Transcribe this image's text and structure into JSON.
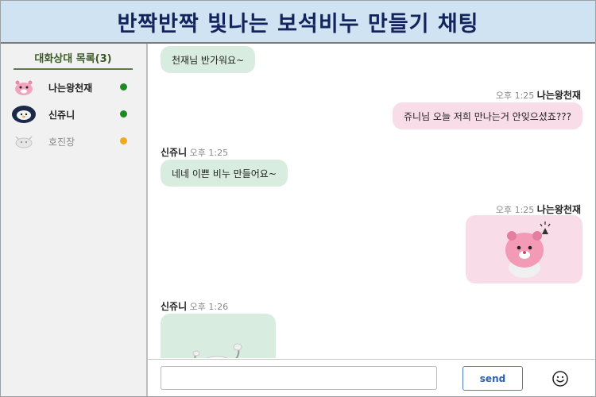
{
  "header": {
    "title": "반짝반짝 빛나는 보석비누 만들기 채팅"
  },
  "sidebar": {
    "title": "대화상대 목록(3)",
    "contacts": [
      {
        "name": "나는왕천재",
        "status_color": "#1e8a24",
        "avatar_icon": "pink-beaver-avatar-icon"
      },
      {
        "name": "신쥬니",
        "status_color": "#1e8a24",
        "avatar_icon": "white-seal-avatar-icon"
      },
      {
        "name": "호진장",
        "status_color": "#f2a81d",
        "avatar_icon": "white-seal-faded-avatar-icon"
      }
    ]
  },
  "messages": [
    {
      "dir": "in",
      "text": "천재님 반가워요~"
    },
    {
      "dir": "out",
      "time": "오후 1:25",
      "sender": "나는왕천재",
      "text": "쥬니님 오늘 저희 만나는거 안잊으셨죠???"
    },
    {
      "dir": "in",
      "sender": "신쥬니",
      "time": "오후 1:25",
      "text": "네네 이쁜 비누 만들어요~"
    },
    {
      "dir": "out",
      "time": "오후 1:25",
      "sender": "나는왕천재",
      "sticker": "pink-beaver-sticker"
    },
    {
      "dir": "in",
      "sender": "신쥬니",
      "time": "오후 1:26",
      "sticker": "white-seal-sticker"
    }
  ],
  "input": {
    "placeholder": "",
    "send_label": "send",
    "emoji_icon": "smiley-icon"
  },
  "colors": {
    "header_bg": "#cfe3f3",
    "title": "#13235c",
    "in_bubble": "#d8ecdf",
    "out_bubble": "#f8dde8",
    "online": "#1e8a24",
    "away": "#f2a81d"
  }
}
